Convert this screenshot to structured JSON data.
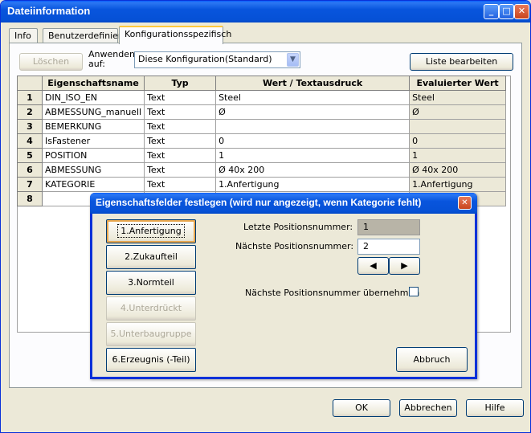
{
  "window": {
    "title": "Dateiinformation"
  },
  "tabs": [
    "Info",
    "Benutzerdefiniert",
    "Konfigurationsspezifisch"
  ],
  "toolbar": {
    "delete_label": "Löschen",
    "apply_label": "Anwenden auf:",
    "config_value": "Diese Konfiguration(Standard)",
    "edit_list_label": "Liste bearbeiten"
  },
  "grid": {
    "headers": [
      "Eigenschaftsname",
      "Typ",
      "Wert / Textausdruck",
      "Evaluierter Wert"
    ],
    "rows": [
      {
        "num": "1",
        "name": "DIN_ISO_EN",
        "type": "Text",
        "value": "Steel",
        "evaluated": "Steel"
      },
      {
        "num": "2",
        "name": "ABMESSUNG_manuell",
        "type": "Text",
        "value": "Ø",
        "evaluated": "Ø"
      },
      {
        "num": "3",
        "name": "BEMERKUNG",
        "type": "Text",
        "value": "",
        "evaluated": ""
      },
      {
        "num": "4",
        "name": "IsFastener",
        "type": "Text",
        "value": "0",
        "evaluated": "0"
      },
      {
        "num": "5",
        "name": "POSITION",
        "type": "Text",
        "value": "1",
        "evaluated": "1"
      },
      {
        "num": "6",
        "name": "ABMESSUNG",
        "type": "Text",
        "value": " Ø 40x 200",
        "evaluated": " Ø 40x 200"
      },
      {
        "num": "7",
        "name": "KATEGORIE",
        "type": "Text",
        "value": "1.Anfertigung",
        "evaluated": "1.Anfertigung"
      },
      {
        "num": "8",
        "name": "",
        "type": "",
        "value": "",
        "evaluated": ""
      }
    ]
  },
  "footer": {
    "ok": "OK",
    "cancel": "Abbrechen",
    "help": "Hilfe"
  },
  "dialog": {
    "title": "Eigenschaftsfelder festlegen (wird nur angezeigt, wenn Kategorie fehlt)",
    "categories": [
      "1.Anfertigung",
      "2.Zukaufteil",
      "3.Normteil",
      "4.Unterdrückt",
      "5.Unterbaugruppe",
      "6.Erzeugnis (-Teil)"
    ],
    "last_pos_label": "Letzte Positionsnummer:",
    "last_pos_value": "1",
    "next_pos_label": "Nächste Positionsnummer:",
    "next_pos_value": "2",
    "prev_arrow": "◀",
    "next_arrow": "▶",
    "adopt_label": "Nächste Positionsnummer übernehmen",
    "cancel": "Abbruch"
  }
}
